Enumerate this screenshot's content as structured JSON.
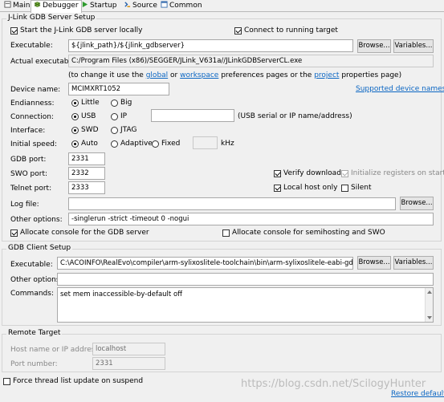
{
  "tabs": [
    {
      "label": "Main",
      "icon": "main-tab-icon",
      "active": false
    },
    {
      "label": "Debugger",
      "icon": "debugger-tab-icon",
      "active": true
    },
    {
      "label": "Startup",
      "icon": "startup-tab-icon",
      "active": false
    },
    {
      "label": "Source",
      "icon": "source-tab-icon",
      "active": false
    },
    {
      "label": "Common",
      "icon": "common-tab-icon",
      "active": false
    }
  ],
  "jlink": {
    "title": "J-Link GDB Server Setup",
    "start_locally_label": "Start the J-Link GDB server locally",
    "start_locally_checked": true,
    "connect_running_label": "Connect to running target",
    "connect_running_checked": true,
    "executable_label": "Executable:",
    "executable_value": "${jlink_path}/${jlink_gdbserver}",
    "browse_label": "Browse...",
    "variables_label": "Variables...",
    "actual_executable_label": "Actual executable:",
    "actual_executable_value": "C:/Program Files (x86)/SEGGER/JLink_V631a//JLinkGDBServerCL.exe",
    "hint_prefix": "(to change it use the",
    "hint_global": "global",
    "hint_or": "or",
    "hint_workspace": "workspace",
    "hint_middle": "preferences pages or the",
    "hint_project": "project",
    "hint_suffix": "properties page)",
    "device_name_label": "Device name:",
    "device_name_value": "MCIMXRT1052",
    "supported_devices_label": "Supported device names",
    "endianness_label": "Endianness:",
    "endianness_options": [
      "Little",
      "Big"
    ],
    "connection_label": "Connection:",
    "connection_options": [
      "USB",
      "IP"
    ],
    "connection_hint": "(USB serial or IP name/address)",
    "interface_label": "Interface:",
    "interface_options": [
      "SWD",
      "JTAG"
    ],
    "initial_speed_label": "Initial speed:",
    "speed_options": [
      "Auto",
      "Adaptive",
      "Fixed"
    ],
    "speed_unit": "kHz",
    "gdb_port_label": "GDB port:",
    "gdb_port_value": "2331",
    "swo_port_label": "SWO port:",
    "swo_port_value": "2332",
    "telnet_port_label": "Telnet port:",
    "telnet_port_value": "2333",
    "verify_downloads_label": "Verify downloads",
    "verify_downloads_checked": true,
    "init_registers_label": "Initialize registers on start",
    "init_registers_checked": true,
    "local_host_only_label": "Local host only",
    "local_host_only_checked": true,
    "silent_label": "Silent",
    "silent_checked": false,
    "log_file_label": "Log file:",
    "log_file_value": "",
    "other_options_label": "Other options:",
    "other_options_value": "-singlerun -strict -timeout 0 -nogui",
    "allocate_console_label": "Allocate console for the GDB server",
    "allocate_console_checked": true,
    "allocate_semihosting_label": "Allocate console for semihosting and SWO",
    "allocate_semihosting_checked": false
  },
  "gdb_client": {
    "title": "GDB Client Setup",
    "executable_label": "Executable:",
    "executable_value": "C:\\ACOINFO\\RealEvo\\compiler\\arm-sylixoslitele-toolchain\\bin\\arm-sylixoslitele-eabi-gdb.exe",
    "browse_label": "Browse...",
    "variables_label": "Variables...",
    "other_options_label": "Other options:",
    "other_options_value": "",
    "commands_label": "Commands:",
    "commands_value": "set mem inaccessible-by-default off"
  },
  "remote": {
    "title": "Remote Target",
    "host_label": "Host name or IP address:",
    "host_value": "localhost",
    "port_label": "Port number:",
    "port_value": "2331"
  },
  "force_thread_label": "Force thread list update on suspend",
  "force_thread_checked": false,
  "restore_defaults_label": "Restore defaults",
  "watermark": "https://blog.csdn.net/ScilogyHunter"
}
